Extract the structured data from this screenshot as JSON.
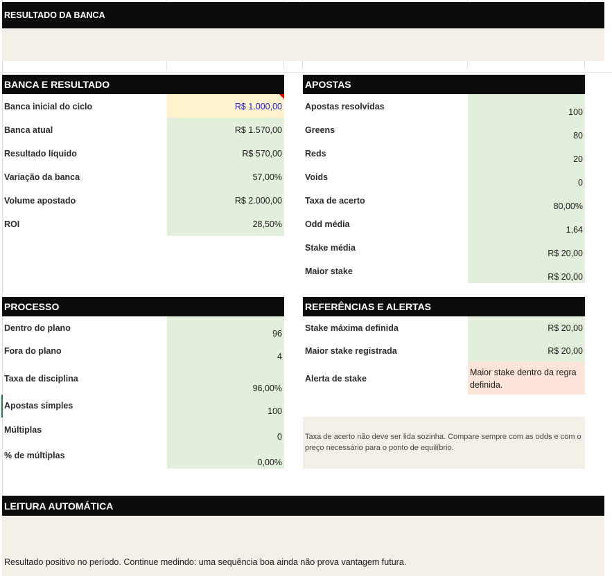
{
  "title": "RESULTADO DA BANCA",
  "banca": {
    "header": "BANCA E RESULTADO",
    "rows": [
      {
        "label": "Banca inicial do ciclo",
        "value": "R$ 1.000,00"
      },
      {
        "label": "Banca atual",
        "value": "R$ 1.570,00"
      },
      {
        "label": "Resultado líquido",
        "value": "R$ 570,00"
      },
      {
        "label": "Variação da banca",
        "value": "57,00%"
      },
      {
        "label": "Volume apostado",
        "value": "R$ 2.000,00"
      },
      {
        "label": "ROI",
        "value": "28,50%"
      }
    ]
  },
  "apostas": {
    "header": "APOSTAS",
    "rows": [
      {
        "label": "Apostas resolvidas",
        "value": "100"
      },
      {
        "label": "Greens",
        "value": "80"
      },
      {
        "label": "Reds",
        "value": "20"
      },
      {
        "label": "Voids",
        "value": "0"
      },
      {
        "label": "Taxa de acerto",
        "value": "80,00%"
      },
      {
        "label": "Odd média",
        "value": "1,64"
      },
      {
        "label": "Stake média",
        "value": "R$ 20,00"
      },
      {
        "label": "Maior stake",
        "value": "R$ 20,00"
      }
    ]
  },
  "processo": {
    "header": "PROCESSO",
    "rows": [
      {
        "label": "Dentro do plano",
        "value": "96"
      },
      {
        "label": "Fora do plano",
        "value": "4"
      },
      {
        "label": "Taxa de disciplina",
        "value": "96,00%"
      },
      {
        "label": "Apostas simples",
        "value": "100"
      },
      {
        "label": "Múltiplas",
        "value": "0"
      },
      {
        "label": "% de múltiplas",
        "value": "0,00%"
      }
    ]
  },
  "referencias": {
    "header": "REFERÊNCIAS E ALERTAS",
    "rows": [
      {
        "label": "Stake máxima definida",
        "value": "R$ 20,00"
      },
      {
        "label": "Maior stake registrada",
        "value": "R$ 20,00"
      },
      {
        "label": "Alerta de stake",
        "value": "Maior stake dentro da regra definida."
      }
    ],
    "note": "Taxa de acerto não deve ser lida sozinha. Compare sempre com as odds e com o preço necessário para o ponto de equilíbrio."
  },
  "leitura": {
    "header": "LEITURA AUTOMÁTICA",
    "text": "Resultado positivo no período. Continue medindo: uma sequência boa ainda não prova vantagem futura."
  },
  "colors": {
    "header_bg": "#0d0d0d",
    "value_green": "#e2efda",
    "input_yellow": "#fff2cc",
    "alert_orange": "#fce4d6",
    "beige": "#f3efe7",
    "input_text_blue": "#1f1fd6",
    "comment_marker_red": "#e00000"
  }
}
